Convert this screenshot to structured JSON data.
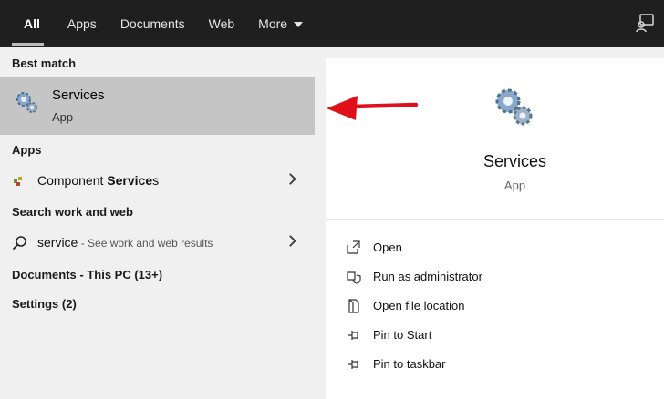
{
  "topbar": {
    "tabs": [
      {
        "label": "All"
      },
      {
        "label": "Apps"
      },
      {
        "label": "Documents"
      },
      {
        "label": "Web"
      },
      {
        "label": "More"
      }
    ],
    "feedback_icon": "feedback-icon"
  },
  "results": {
    "best_match_heading": "Best match",
    "best_match": {
      "title": "Services",
      "subtitle": "App",
      "icon": "services-gears-icon"
    },
    "apps_heading": "Apps",
    "apps": [
      {
        "label_prefix": "Component ",
        "label_bold": "Service",
        "label_suffix": "s",
        "icon": "component-services-icon"
      }
    ],
    "web_heading": "Search work and web",
    "web": [
      {
        "query": "service",
        "hint": " - See work and web results",
        "icon": "search-icon"
      }
    ],
    "documents_heading": "Documents - This PC (13+)",
    "settings_heading": "Settings (2)"
  },
  "preview": {
    "title": "Services",
    "subtitle": "App",
    "actions": [
      {
        "label": "Open",
        "icon": "open-icon"
      },
      {
        "label": "Run as administrator",
        "icon": "shield-icon"
      },
      {
        "label": "Open file location",
        "icon": "file-location-icon"
      },
      {
        "label": "Pin to Start",
        "icon": "pin-icon"
      },
      {
        "label": "Pin to taskbar",
        "icon": "pin-icon"
      }
    ]
  },
  "colors": {
    "annotation_arrow": "#e0101a",
    "highlight": "#c5c5c5",
    "topbar": "#1f1f1f"
  }
}
